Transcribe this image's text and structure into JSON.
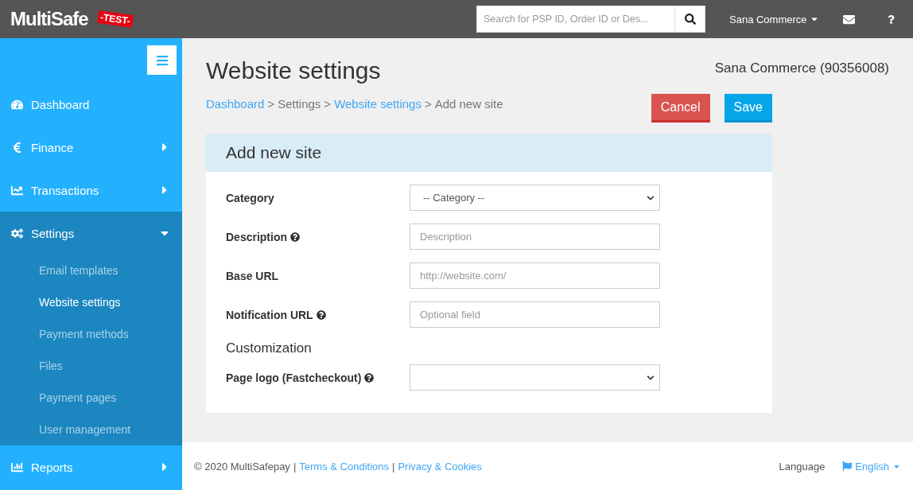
{
  "topbar": {
    "logo": "MultiSafe",
    "badge": "-TEST-",
    "search": {
      "placeholder": "Search for PSP ID, Order ID or Des..."
    },
    "account": "Sana Commerce"
  },
  "sidebar": {
    "items": [
      {
        "label": "Dashboard"
      },
      {
        "label": "Finance",
        "expanded": false
      },
      {
        "label": "Transactions",
        "expanded": false
      },
      {
        "label": "Settings",
        "expanded": true,
        "children": [
          {
            "label": "Email templates",
            "selected": false
          },
          {
            "label": "Website settings",
            "selected": true
          },
          {
            "label": "Payment methods",
            "selected": false
          },
          {
            "label": "Files",
            "selected": false
          },
          {
            "label": "Payment pages",
            "selected": false
          },
          {
            "label": "User management",
            "selected": false
          }
        ]
      },
      {
        "label": "Reports",
        "expanded": false
      }
    ]
  },
  "page": {
    "title": "Website settings",
    "merchant": "Sana Commerce (90356008)",
    "breadcrumb_separator": ">",
    "breadcrumb": [
      {
        "label": "Dashboard",
        "link": true
      },
      {
        "label": "Settings",
        "link": false
      },
      {
        "label": "Website settings",
        "link": true
      },
      {
        "label": "Add new site",
        "link": false
      }
    ],
    "buttons": [
      {
        "label": "Cancel",
        "kind": "danger"
      },
      {
        "label": "Save",
        "kind": "primary"
      }
    ]
  },
  "form": {
    "title": "Add new site",
    "fields": [
      {
        "kind": "select",
        "label": "Category",
        "help": false,
        "value": "-- Category --"
      },
      {
        "kind": "text",
        "label": "Description",
        "help": true,
        "placeholder": "Description"
      },
      {
        "kind": "text",
        "label": "Base URL",
        "help": false,
        "placeholder": "http://website.com/"
      },
      {
        "kind": "text",
        "label": "Notification URL",
        "help": true,
        "placeholder": "Optional field"
      },
      {
        "kind": "heading",
        "label": "Customization"
      },
      {
        "kind": "select",
        "label": "Page logo (Fastcheckout)",
        "help": true
      }
    ]
  },
  "footer": {
    "copyright": "© 2020 MultiSafepay",
    "separator": "|",
    "links": [
      "Terms & Conditions",
      "Privacy & Cookies"
    ],
    "language_label": "Language",
    "language": "English"
  }
}
